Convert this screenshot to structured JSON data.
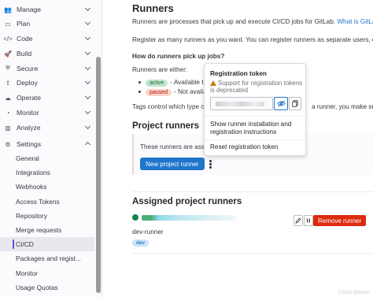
{
  "sidebar": {
    "items": [
      {
        "label": "Manage",
        "icon": "users-icon",
        "glyph": "👥",
        "expanded": false
      },
      {
        "label": "Plan",
        "icon": "issues-icon",
        "glyph": "▭",
        "expanded": false
      },
      {
        "label": "Code",
        "icon": "code-icon",
        "glyph": "</>",
        "expanded": false
      },
      {
        "label": "Build",
        "icon": "rocket-icon",
        "glyph": "🚀",
        "expanded": false
      },
      {
        "label": "Secure",
        "icon": "shield-icon",
        "glyph": "⛨",
        "expanded": false
      },
      {
        "label": "Deploy",
        "icon": "deploy-icon",
        "glyph": "⇪",
        "expanded": false
      },
      {
        "label": "Operate",
        "icon": "cloud-icon",
        "glyph": "☁",
        "expanded": false
      },
      {
        "label": "Monitor",
        "icon": "monitor-icon",
        "glyph": "◔",
        "expanded": false
      },
      {
        "label": "Analyze",
        "icon": "chart-icon",
        "glyph": "▥",
        "expanded": false
      },
      {
        "label": "Settings",
        "icon": "gear-icon",
        "glyph": "⚙",
        "expanded": true
      }
    ],
    "settings_sub": [
      "General",
      "Integrations",
      "Webhooks",
      "Access Tokens",
      "Repository",
      "Merge requests",
      "CI/CD",
      "Packages and regist...",
      "Monitor",
      "Usage Quotas"
    ],
    "active_sub": "CI/CD"
  },
  "main": {
    "title": "Runners",
    "intro": "Runners are processes that pick up and execute CI/CD jobs for GitLab.",
    "intro_link": "What is GitLab Re",
    "register_text": "Register as many runners as you want. You can register runners as separate users, on se",
    "pickup_heading": "How do runners pick up jobs?",
    "either": "Runners are either:",
    "active_badge": "active",
    "active_text": "- Available to",
    "paused_badge": "paused",
    "paused_text": "- Not availab",
    "tags_text_left": "Tags control which type of",
    "tags_text_right": "a runner, you make sure",
    "project_runners_heading": "Project runners",
    "assign_text": "These runners are assig",
    "new_runner_button": "New project runner",
    "assigned_heading": "Assigned project runners",
    "runner_name": "dev-runner",
    "runner_tag": "dev",
    "remove_button": "Remove runner"
  },
  "popover": {
    "title": "Registration token",
    "warning": "Support for registration tokens is deprecated",
    "show_instructions": "Show runner installation and registration instructions",
    "reset_token": "Reset registration token"
  },
  "watermark": "CSDN @Kevin"
}
